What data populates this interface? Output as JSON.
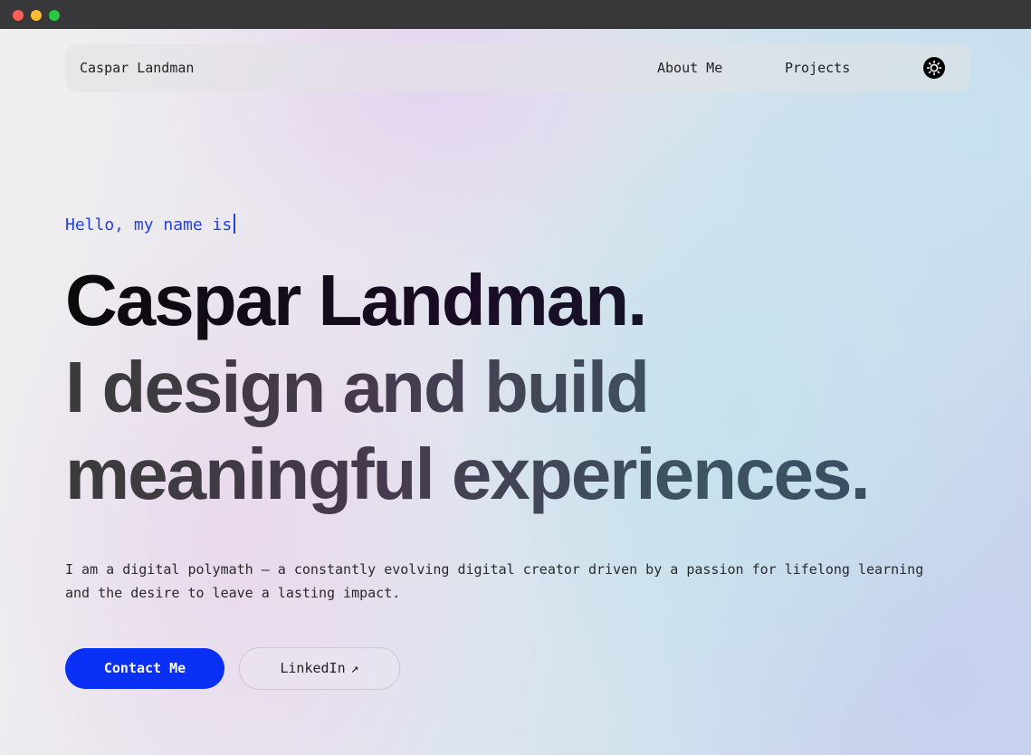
{
  "nav": {
    "brand": "Caspar Landman",
    "links": [
      "About Me",
      "Projects"
    ],
    "theme_toggle_icon": "sun-icon"
  },
  "hero": {
    "greeting": "Hello, my name is",
    "name": "Caspar Landman.",
    "tagline_1": "I design and build",
    "tagline_2": "meaningful experiences.",
    "bio": "I am a digital polymath — a constantly evolving digital creator driven by a passion for lifelong learning and the desire to leave a lasting impact."
  },
  "buttons": {
    "contact": "Contact Me",
    "linkedin": "LinkedIn",
    "linkedin_icon": "arrow-up-right-icon"
  },
  "colors": {
    "accent": "#0a2ff5",
    "greeting": "#2340e0"
  }
}
